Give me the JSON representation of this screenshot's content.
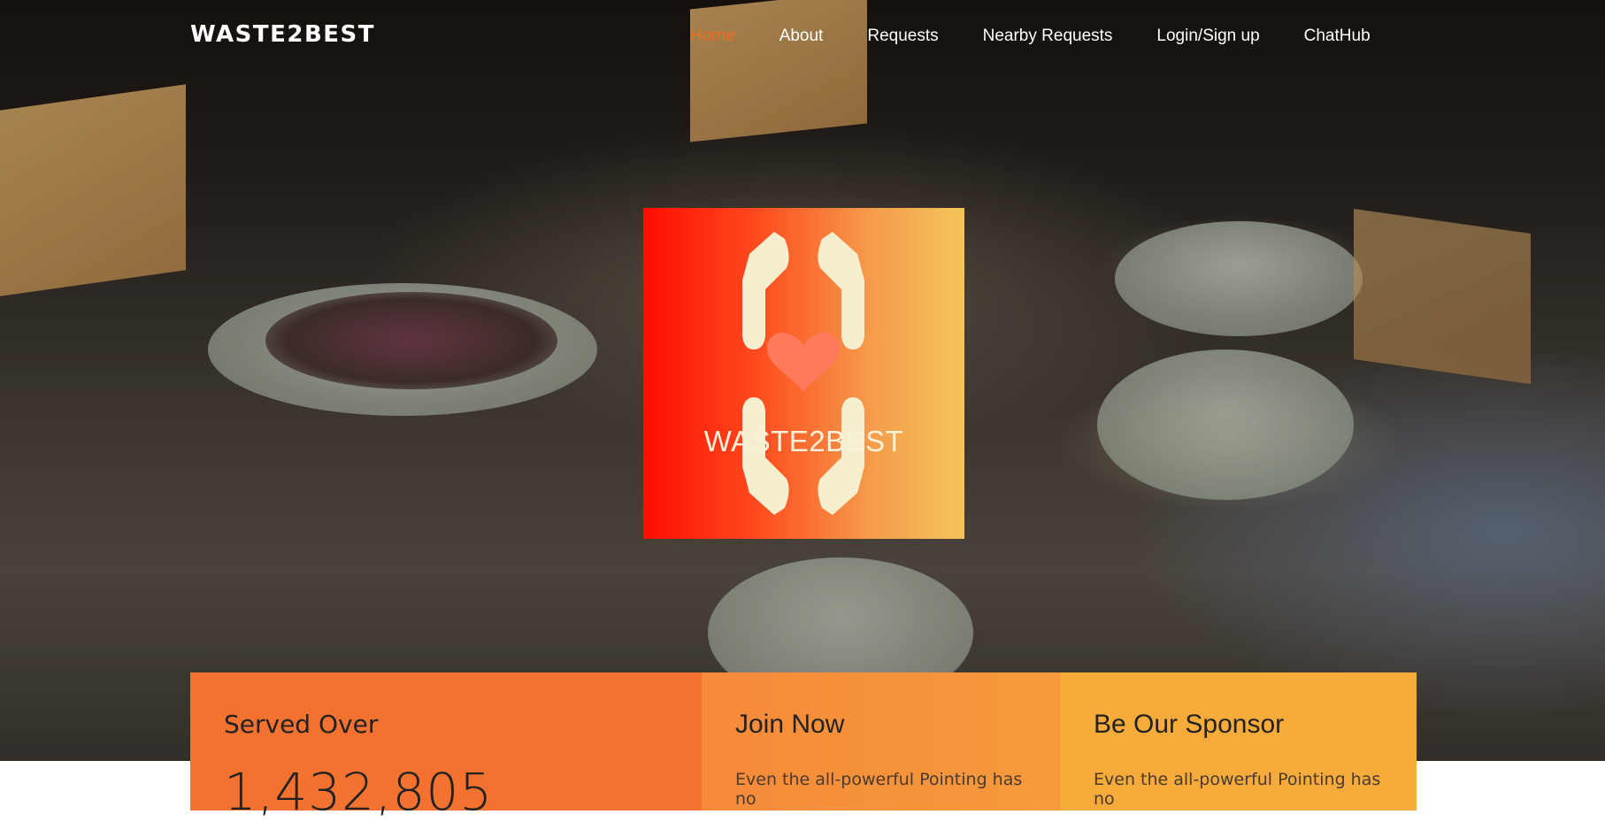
{
  "nav": {
    "brand": "WASTE2BEST",
    "items": [
      {
        "label": "Home",
        "active": true
      },
      {
        "label": "About"
      },
      {
        "label": "Requests"
      },
      {
        "label": "Nearby Requests"
      },
      {
        "label": "Login/Sign up"
      },
      {
        "label": "ChatHub"
      }
    ]
  },
  "logo": {
    "text": "WASTE2BEST"
  },
  "cards": {
    "served": {
      "title": "Served Over",
      "count": "1,432,805"
    },
    "join": {
      "title": "Join Now",
      "text": "Even the all-powerful Pointing has no"
    },
    "sponsor": {
      "title": "Be Our Sponsor",
      "text": "Even the all-powerful Pointing has no"
    }
  },
  "colors": {
    "accent": "#f26b21",
    "logo_left": "#ff0c00",
    "logo_right": "#f4c45a",
    "card1": "#f47230",
    "card2": "#f68a3a",
    "card3": "#f7ab3a"
  },
  "icons": {
    "logo": "hands-heart-icon"
  }
}
